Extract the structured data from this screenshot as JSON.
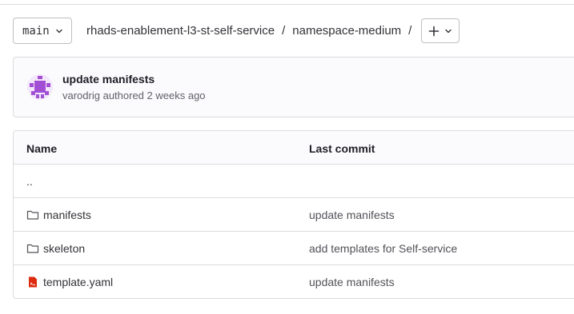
{
  "toolbar": {
    "branch_label": "main",
    "breadcrumb": [
      "rhads-enablement-l3-st-self-service",
      "namespace-medium"
    ],
    "separator": "/",
    "add_label": "+"
  },
  "commit": {
    "title": "update manifests",
    "author": "varodrig",
    "action": "authored",
    "when": "2 weeks ago",
    "avatar_color": "#a24fd6"
  },
  "table": {
    "columns": [
      "Name",
      "Last commit"
    ],
    "parent_link": "..",
    "rows": [
      {
        "name": "manifests",
        "icon": "folder-icon",
        "last_commit": "update manifests"
      },
      {
        "name": "skeleton",
        "icon": "folder-icon",
        "last_commit": "add templates for Self-service"
      },
      {
        "name": "template.yaml",
        "icon": "yaml-file-icon",
        "last_commit": "update manifests"
      }
    ]
  },
  "colors": {
    "border": "#dcdcde",
    "text": "#333238",
    "yaml_icon": "#dd2b0e"
  }
}
